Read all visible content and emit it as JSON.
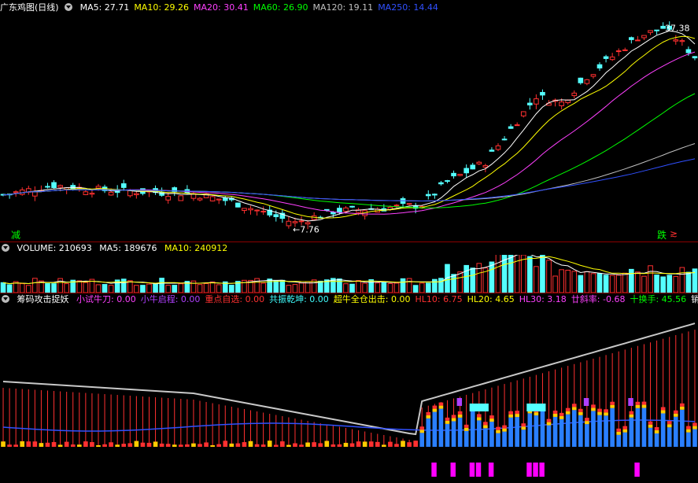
{
  "main": {
    "title": "广东鸡图(日线)",
    "ma": [
      {
        "label": "MA5: 27.71",
        "color": "#ffffff"
      },
      {
        "label": "MA10: 29.26",
        "color": "#ffff00"
      },
      {
        "label": "MA20: 30.41",
        "color": "#ff40ff"
      },
      {
        "label": "MA60: 26.90",
        "color": "#00ff00"
      },
      {
        "label": "MA120: 19.11",
        "color": "#c0c0c0"
      },
      {
        "label": "MA250: 14.44",
        "color": "#3050ff"
      }
    ],
    "high_label": "37.38",
    "low_label": "7.76",
    "left_mark": "减",
    "right_mark": "跌",
    "right_mark2": "≳"
  },
  "volume": {
    "title": "VOLUME: 210693",
    "ma5": "MA5: 189676",
    "ma10": "MA10: 240912"
  },
  "indicator": {
    "title": "筹码攻击捉妖",
    "items": [
      {
        "label": "小试牛刀: 0.00",
        "color": "#ff40ff"
      },
      {
        "label": "小牛启程: 0.00",
        "color": "#b040ff"
      },
      {
        "label": "重点自选: 0.00",
        "color": "#ff3030"
      },
      {
        "label": "共振乾坤: 0.00",
        "color": "#40ffff"
      },
      {
        "label": "超牛全仓出击: 0.00",
        "color": "#ffff00"
      },
      {
        "label": "HL10: 6.75",
        "color": "#ff3030"
      },
      {
        "label": "HL20: 4.65",
        "color": "#ffff00"
      },
      {
        "label": "HL30: 3.18",
        "color": "#ff40ff"
      },
      {
        "label": "廿斜率: -0.68",
        "color": "#ff40ff"
      },
      {
        "label": "十换手: 45.56",
        "color": "#00ff00"
      },
      {
        "label": "销",
        "color": "#ffffff"
      }
    ]
  }
}
